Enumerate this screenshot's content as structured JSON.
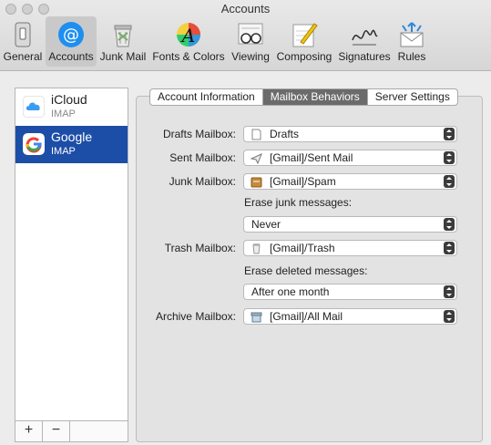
{
  "window": {
    "title": "Accounts"
  },
  "toolbar": {
    "items": [
      {
        "label": "General",
        "icon": "general-icon"
      },
      {
        "label": "Accounts",
        "icon": "at-sign-icon"
      },
      {
        "label": "Junk Mail",
        "icon": "trash-can-icon"
      },
      {
        "label": "Fonts & Colors",
        "icon": "font-palette-icon"
      },
      {
        "label": "Viewing",
        "icon": "glasses-icon"
      },
      {
        "label": "Composing",
        "icon": "pencil-paper-icon"
      },
      {
        "label": "Signatures",
        "icon": "signature-icon"
      },
      {
        "label": "Rules",
        "icon": "envelope-arrows-icon"
      }
    ],
    "active": "Accounts"
  },
  "accounts": [
    {
      "name": "iCloud",
      "type": "IMAP",
      "selected": false
    },
    {
      "name": "Google",
      "type": "IMAP",
      "selected": true
    }
  ],
  "account_buttons": {
    "add": "+",
    "remove": "−"
  },
  "tabs": [
    "Account Information",
    "Mailbox Behaviors",
    "Server Settings"
  ],
  "active_tab": "Mailbox Behaviors",
  "form": {
    "drafts_label": "Drafts Mailbox:",
    "drafts_value": "Drafts",
    "sent_label": "Sent Mailbox:",
    "sent_value": "[Gmail]/Sent Mail",
    "junk_label": "Junk Mailbox:",
    "junk_value": "[Gmail]/Spam",
    "erase_junk_label": "Erase junk messages:",
    "erase_junk_value": "Never",
    "trash_label": "Trash Mailbox:",
    "trash_value": "[Gmail]/Trash",
    "erase_deleted_label": "Erase deleted messages:",
    "erase_deleted_value": "After one month",
    "archive_label": "Archive Mailbox:",
    "archive_value": "[Gmail]/All Mail"
  },
  "colors": {
    "selection": "#1c4ea7",
    "active_tab": "#6b6b6b"
  }
}
